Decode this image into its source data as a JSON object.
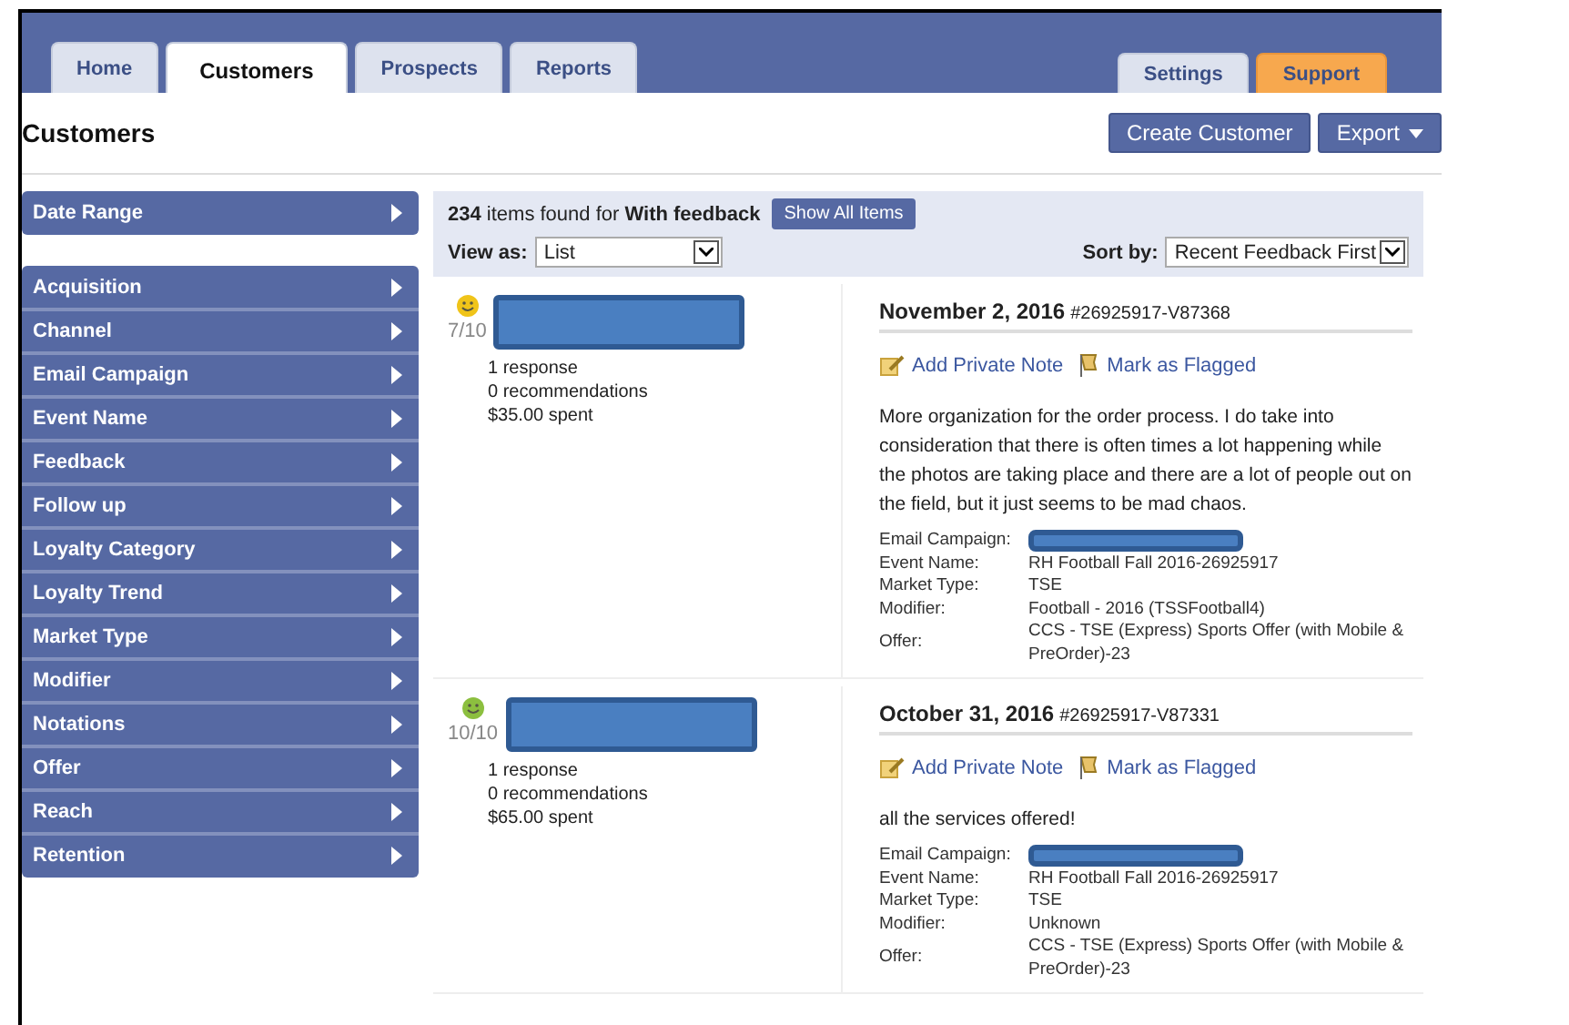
{
  "nav": {
    "tabs_left": [
      {
        "label": "Home",
        "selected": false
      },
      {
        "label": "Customers",
        "selected": true
      },
      {
        "label": "Prospects",
        "selected": false
      },
      {
        "label": "Reports",
        "selected": false
      }
    ],
    "tabs_right": [
      {
        "label": "Settings",
        "selected": false
      },
      {
        "label": "Support",
        "selected": false,
        "kind": "accent"
      }
    ]
  },
  "page": {
    "title": "Customers",
    "buttons": [
      {
        "label": "Create Customer",
        "kind": "plain"
      },
      {
        "label": "Export",
        "kind": "menu"
      }
    ]
  },
  "sidebar": {
    "top": [
      {
        "label": "Date Range"
      }
    ],
    "filters": [
      {
        "label": "Acquisition"
      },
      {
        "label": "Channel"
      },
      {
        "label": "Email Campaign"
      },
      {
        "label": "Event Name"
      },
      {
        "label": "Feedback"
      },
      {
        "label": "Follow up"
      },
      {
        "label": "Loyalty Category"
      },
      {
        "label": "Loyalty Trend"
      },
      {
        "label": "Market Type"
      },
      {
        "label": "Modifier"
      },
      {
        "label": "Notations"
      },
      {
        "label": "Offer"
      },
      {
        "label": "Reach"
      },
      {
        "label": "Retention"
      }
    ]
  },
  "results": {
    "summary": "**234** items found for **With feedback**",
    "show_all": "Show All Items",
    "view_label": "View as:",
    "view_value": "List",
    "sort_label": "Sort by:",
    "sort_value": "Recent Feedback First"
  },
  "items": [
    {
      "color": "#f0c419",
      "score": "7/10",
      "stats": [
        "1 response",
        "0 recommendations",
        "$35.00 spent"
      ],
      "date": "November 2, 2016",
      "ref": "#26925917-V87368",
      "actions": [
        "Add Private Note",
        "Mark as Flagged"
      ],
      "comment": "More organization for the order process. I do take into consideration that there is often times a lot happening while the photos are taking place and there are a lot of people out on the field, but it just seems to be mad chaos.",
      "details": [
        {
          "label": "Email Campaign:",
          "redacted": true
        },
        {
          "label": "Event Name:",
          "value": "RH Football Fall 2016-26925917"
        },
        {
          "label": "Market Type:",
          "value": "TSE"
        },
        {
          "label": "Modifier:",
          "value": "Football - 2016 (TSSFootball4)"
        },
        {
          "label": "Offer:",
          "value": "CCS - TSE (Express) Sports Offer (with Mobile & PreOrder)-23"
        }
      ]
    },
    {
      "color": "#8cbf3f",
      "score": "10/10",
      "stats": [
        "1 response",
        "0 recommendations",
        "$65.00 spent"
      ],
      "date": "October 31, 2016",
      "ref": "#26925917-V87331",
      "actions": [
        "Add Private Note",
        "Mark as Flagged"
      ],
      "comment": "all the services offered!",
      "details": [
        {
          "label": "Email Campaign:",
          "redacted": true
        },
        {
          "label": "Event Name:",
          "value": "RH Football Fall 2016-26925917"
        },
        {
          "label": "Market Type:",
          "value": "TSE"
        },
        {
          "label": "Modifier:",
          "value": "Unknown"
        },
        {
          "label": "Offer:",
          "value": "CCS - TSE (Express) Sports Offer (with Mobile & PreOrder)-23"
        }
      ]
    }
  ]
}
